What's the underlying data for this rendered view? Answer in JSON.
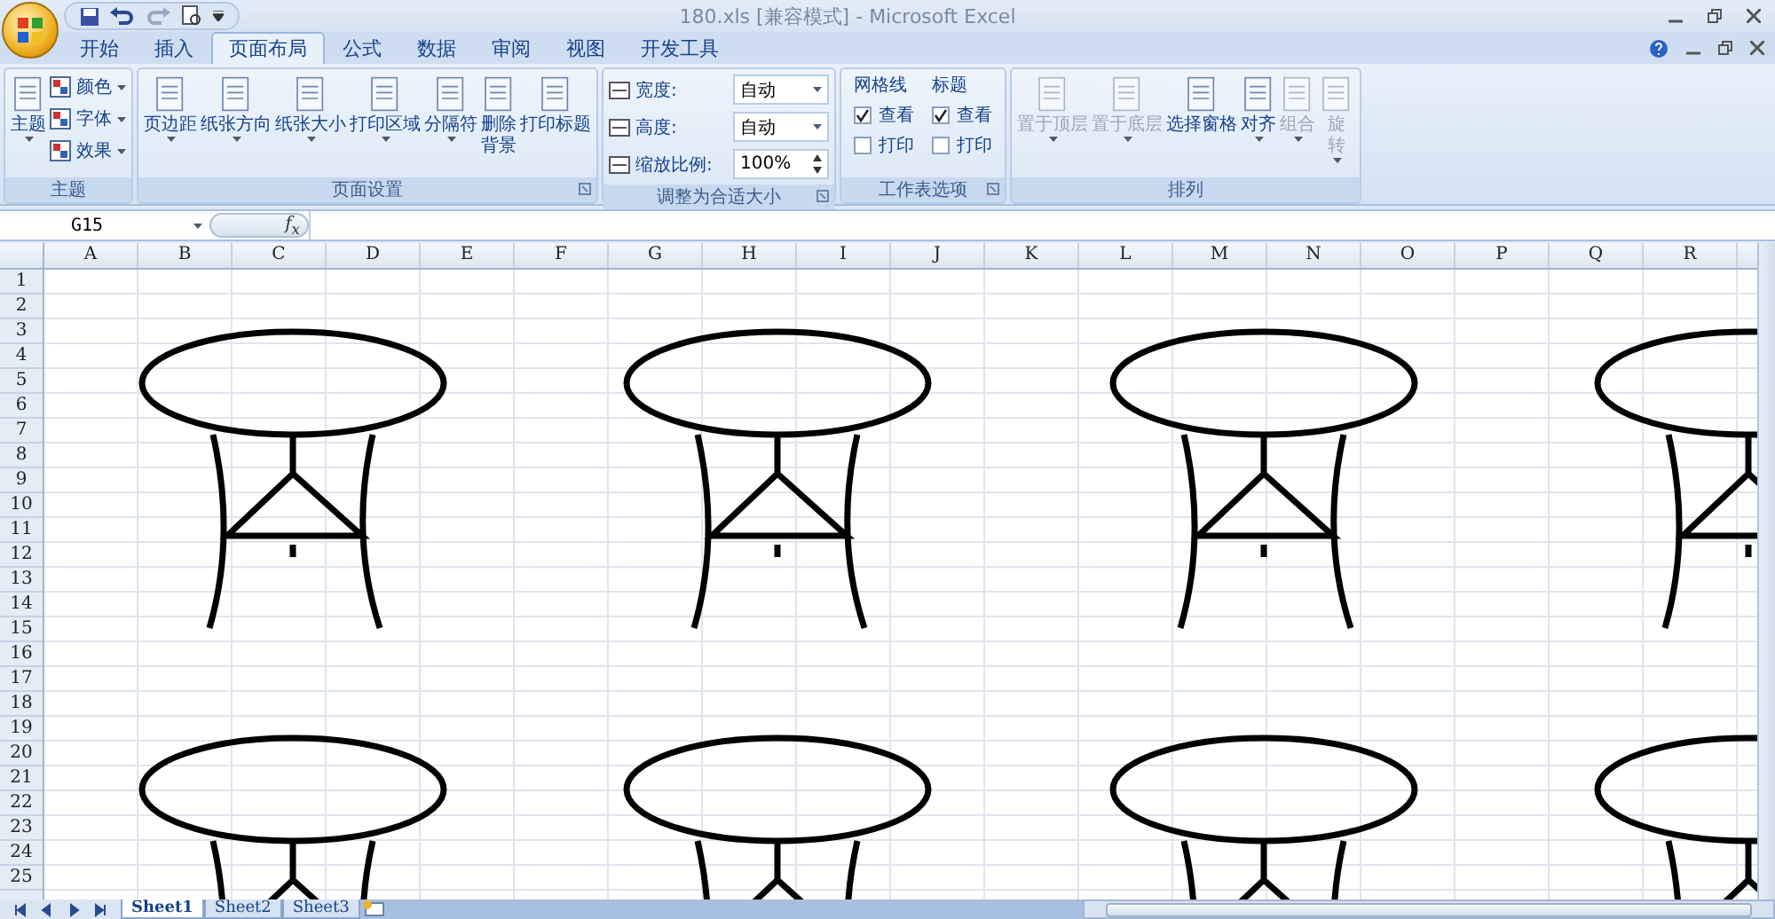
{
  "window": {
    "title": "180.xls  [兼容模式] - Microsoft Excel"
  },
  "tabs": [
    {
      "label": "开始",
      "selected": false
    },
    {
      "label": "插入",
      "selected": false
    },
    {
      "label": "页面布局",
      "selected": true
    },
    {
      "label": "公式",
      "selected": false
    },
    {
      "label": "数据",
      "selected": false
    },
    {
      "label": "审阅",
      "selected": false
    },
    {
      "label": "视图",
      "selected": false
    },
    {
      "label": "开发工具",
      "selected": false
    }
  ],
  "ribbon": {
    "groups": [
      {
        "title": "主题",
        "launcher": false,
        "items": [
          {
            "kind": "large",
            "label": [
              "主题"
            ],
            "dropdown": true
          },
          {
            "kind": "small",
            "label": "颜色",
            "dropdown": true
          },
          {
            "kind": "small",
            "label": "字体",
            "dropdown": true
          },
          {
            "kind": "small",
            "label": "效果",
            "dropdown": true
          }
        ]
      },
      {
        "title": "页面设置",
        "launcher": true,
        "items": [
          {
            "kind": "large",
            "label": [
              "页边距"
            ],
            "dropdown": true
          },
          {
            "kind": "large",
            "label": [
              "纸张方向"
            ],
            "dropdown": true
          },
          {
            "kind": "large",
            "label": [
              "纸张大小"
            ],
            "dropdown": true
          },
          {
            "kind": "large",
            "label": [
              "打印区域"
            ],
            "dropdown": true
          },
          {
            "kind": "large",
            "label": [
              "分隔符"
            ],
            "dropdown": true
          },
          {
            "kind": "large",
            "label": [
              "删除",
              "背景"
            ],
            "dropdown": false
          },
          {
            "kind": "large",
            "label": [
              "打印标题"
            ],
            "dropdown": false
          }
        ]
      },
      {
        "title": "调整为合适大小",
        "launcher": true,
        "items": [
          {
            "kind": "field",
            "label": "宽度:",
            "value": "自动"
          },
          {
            "kind": "field",
            "label": "高度:",
            "value": "自动"
          },
          {
            "kind": "spinner",
            "label": "缩放比例:",
            "value": "100%"
          }
        ]
      },
      {
        "title": "工作表选项",
        "launcher": true,
        "items": [
          {
            "kind": "checkgroup",
            "label": "网格线",
            "options": [
              {
                "label": "查看",
                "checked": true
              },
              {
                "label": "打印",
                "checked": false
              }
            ]
          },
          {
            "kind": "checkgroup",
            "label": "标题",
            "options": [
              {
                "label": "查看",
                "checked": true
              },
              {
                "label": "打印",
                "checked": false
              }
            ]
          }
        ]
      },
      {
        "title": "排列",
        "launcher": false,
        "items": [
          {
            "kind": "large",
            "label": [
              "置于顶层"
            ],
            "dropdown": true,
            "disabled": true
          },
          {
            "kind": "large",
            "label": [
              "置于底层"
            ],
            "dropdown": true,
            "disabled": true
          },
          {
            "kind": "large",
            "label": [
              "选择窗格"
            ],
            "dropdown": false,
            "disabled": false
          },
          {
            "kind": "large",
            "label": [
              "对齐"
            ],
            "dropdown": true,
            "disabled": false
          },
          {
            "kind": "large",
            "label": [
              "组合"
            ],
            "dropdown": true,
            "disabled": true
          },
          {
            "kind": "large",
            "label": [
              "旋",
              "转"
            ],
            "dropdown": true,
            "disabled": true
          }
        ]
      }
    ]
  },
  "formula_bar": {
    "name_box": "G15",
    "function_label": "f$_{x}$"
  },
  "sheet": {
    "columns": [
      "A",
      "B",
      "C",
      "D",
      "E",
      "F",
      "G",
      "H",
      "I",
      "J",
      "K",
      "L",
      "M",
      "N",
      "O",
      "P",
      "Q",
      "R"
    ],
    "rows": [
      "1",
      "2",
      "3",
      "4",
      "5",
      "6",
      "7",
      "8",
      "9",
      "10",
      "11",
      "12",
      "13",
      "14",
      "15",
      "16",
      "17",
      "18",
      "19",
      "20",
      "21",
      "22",
      "23",
      "24",
      "25"
    ]
  },
  "sheet_tabs": [
    {
      "label": "Sheet1",
      "selected": true
    },
    {
      "label": "Sheet2",
      "selected": false
    },
    {
      "label": "Sheet3",
      "selected": false
    }
  ]
}
